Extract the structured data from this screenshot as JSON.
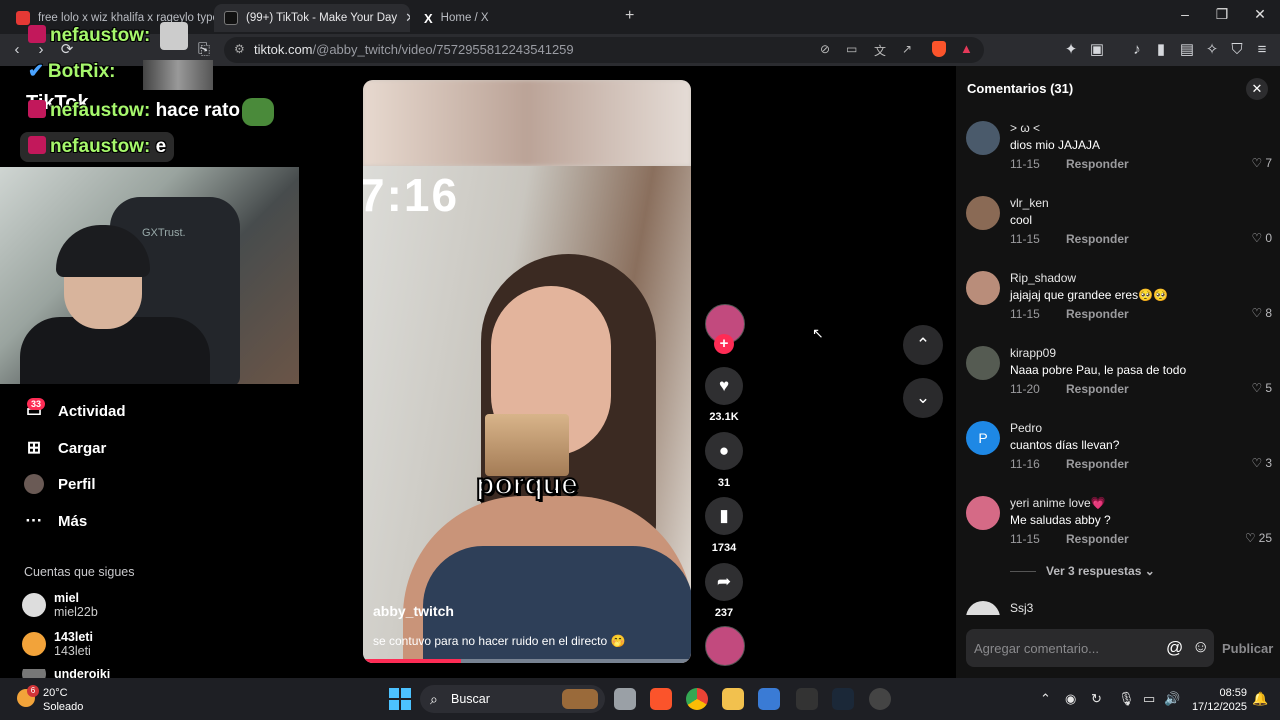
{
  "browser": {
    "tabs": [
      {
        "label": "free lolo x wiz khalifa x rageylo type",
        "active": false
      },
      {
        "label": "(99+) TikTok - Make Your Day",
        "active": true
      },
      {
        "label": "Home / X",
        "active": false
      }
    ],
    "new_tab_label": "+",
    "url_host": "tiktok.com",
    "url_path": "/@abby_twitch/video/7572955812243541259"
  },
  "stream_overlay": {
    "chat": [
      {
        "user": "nefaustow:",
        "message": ""
      },
      {
        "user": "BotRix:",
        "message": ""
      },
      {
        "user": "nefaustow:",
        "message": "hace rato"
      },
      {
        "user": "nefaustow:",
        "message": "e"
      }
    ],
    "tiktok_logo_text": "TikTok",
    "chair_brand": "GXTrust."
  },
  "sidebar": {
    "notifications_count": "33",
    "items": [
      {
        "label": "Actividad",
        "icon": "inbox-icon"
      },
      {
        "label": "Cargar",
        "icon": "upload-icon"
      },
      {
        "label": "Perfil",
        "icon": "profile-icon"
      },
      {
        "label": "Más",
        "icon": "more-icon"
      }
    ],
    "following_title": "Cuentas que sigues",
    "following": [
      {
        "name": "miel",
        "handle": "miel22b"
      },
      {
        "name": "143leti",
        "handle": "143leti"
      },
      {
        "name": "underoiki",
        "handle": ""
      }
    ]
  },
  "video": {
    "timestamp_overlay": "7:16",
    "caption_word": "porque",
    "author": "abby_twitch",
    "description": "se contuvo para no hacer ruido en el directo 🤭",
    "progress_fraction": 0.3
  },
  "actions": {
    "likes": "23.1K",
    "comments": "31",
    "saves": "1734",
    "shares": "237"
  },
  "comments_panel": {
    "title": "Comentarios (31)",
    "items": [
      {
        "user": "> ω <",
        "text": "dios mio JAJAJA",
        "date": "11-15",
        "reply": "Responder",
        "likes": "7",
        "avatar_color": "#4a5a6b"
      },
      {
        "user": "vlr_ken",
        "text": "cool",
        "date": "11-15",
        "reply": "Responder",
        "likes": "0",
        "avatar_color": "#8a6a55"
      },
      {
        "user": "Rip_shadow",
        "text": "jajajaj que grandee eres🥺🥺",
        "date": "11-15",
        "reply": "Responder",
        "likes": "8",
        "avatar_color": "#b98d7a"
      },
      {
        "user": "kirapp09",
        "text": "Naaa pobre Pau, le pasa de todo",
        "date": "11-20",
        "reply": "Responder",
        "likes": "5",
        "avatar_color": "#555b52"
      },
      {
        "user": "Pedro",
        "text": "cuantos días llevan?",
        "date": "11-16",
        "reply": "Responder",
        "likes": "3",
        "avatar_color": "#1e88e5",
        "avatar_letter": "P"
      },
      {
        "user": "yeri anime love💗",
        "text": "Me saludas abby ?",
        "date": "11-15",
        "reply": "Responder",
        "likes": "25",
        "avatar_color": "#d56a86"
      },
      {
        "user": "Ssj3",
        "text": "",
        "date": "",
        "reply": "",
        "likes": "",
        "avatar_color": "#dddddd"
      }
    ],
    "more_replies": "Ver 3 respuestas",
    "input_placeholder": "Agregar comentario...",
    "publish_label": "Publicar"
  },
  "taskbar": {
    "weather_temp": "20°C",
    "weather_desc": "Soleado",
    "weather_badge": "6",
    "search_label": "Buscar",
    "time": "08:59",
    "date": "17/12/2025"
  }
}
